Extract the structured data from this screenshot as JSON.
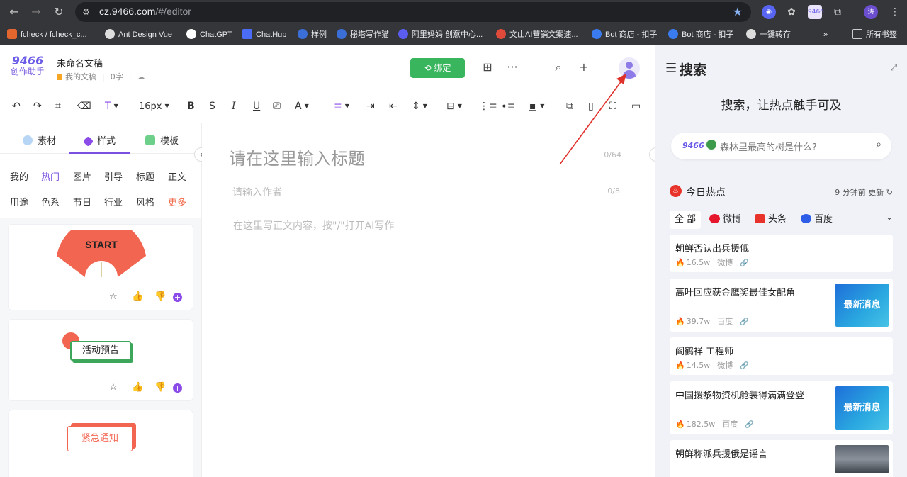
{
  "browser": {
    "url_host": "cz.9466.com",
    "url_path": "/#/editor",
    "profile_initial": "涛",
    "bookmarks": [
      "fcheck / fcheck_c...",
      "Ant Design Vue",
      "ChatGPT",
      "ChatHub",
      "样例",
      "秘塔写作猫",
      "阿里妈妈 创意中心...",
      "文山AI营销文案速...",
      "Bot 商店 - 扣子",
      "Bot 商店 - 扣子",
      "一键转存"
    ],
    "bookmarks_overflow": "»",
    "all_bookmarks": "所有书签",
    "ext_label": "9466"
  },
  "header": {
    "logo_top": "9466",
    "logo_bottom": "创作助手",
    "doc_title": "未命名文稿",
    "folder": "我的文稿",
    "word_count": "0字",
    "bind_label": "绑定"
  },
  "toolbar": {
    "font_size": "16px"
  },
  "left_panel": {
    "tabs": [
      "素材",
      "样式",
      "模板"
    ],
    "active_tab": "样式",
    "categories_row1": [
      "我的",
      "热门",
      "图片",
      "引导",
      "标题",
      "正文"
    ],
    "categories_row2": [
      "用途",
      "色系",
      "节日",
      "行业",
      "风格",
      "更多"
    ],
    "cards": [
      {
        "label": "START"
      },
      {
        "label": "活动预告"
      },
      {
        "label": "紧急通知"
      }
    ]
  },
  "editor": {
    "title_placeholder": "请在这里输入标题",
    "title_count": "0/64",
    "author_placeholder": "请输入作者",
    "author_count": "0/8",
    "body_placeholder": "在这里写正文内容，按\"/\"打开AI写作"
  },
  "right_panel": {
    "title": "搜索",
    "slogan": "搜索，让热点触手可及",
    "search_brand": "9466",
    "search_placeholder": "森林里最高的树是什么?",
    "hot_title": "今日热点",
    "updated": "9 分钟前 更新",
    "sources": [
      "全 部",
      "微博",
      "头条",
      "百度"
    ],
    "news": [
      {
        "title": "朝鲜否认出兵援俄",
        "heat": "16.5w",
        "source": "微博",
        "thumb": ""
      },
      {
        "title": "高叶回应获金鹰奖最佳女配角",
        "heat": "39.7w",
        "source": "百度",
        "thumb": "最新消息"
      },
      {
        "title": "阎鹤祥 工程师",
        "heat": "14.5w",
        "source": "微博",
        "thumb": ""
      },
      {
        "title": "中国援黎物资机舱装得满满登登",
        "heat": "182.5w",
        "source": "百度",
        "thumb": "最新消息"
      },
      {
        "title": "朝鲜称派兵援俄是谣言",
        "heat": "",
        "source": "",
        "thumb": ""
      }
    ]
  },
  "colors": {
    "accent": "#7b4fe0",
    "bind_green": "#39b55d",
    "hot_red": "#e8332a",
    "more_orange": "#f06a4a"
  }
}
